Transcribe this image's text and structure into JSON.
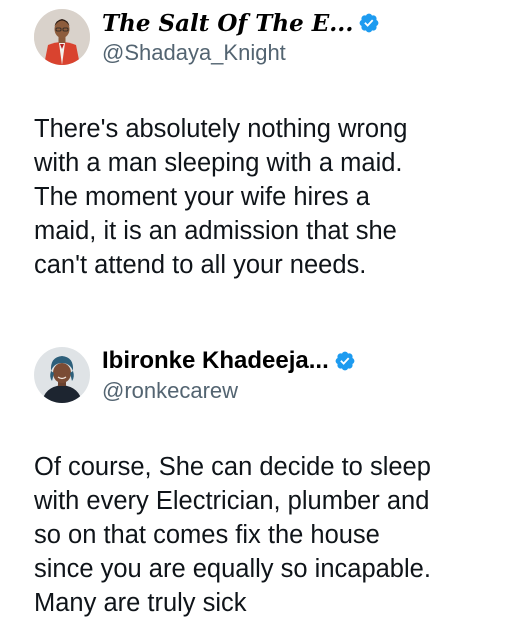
{
  "tweets": [
    {
      "display_name": "The Salt Of The E...",
      "handle": "@Shadaya_Knight",
      "verified": true,
      "avatar_icon": "man-in-red-suit-avatar",
      "text": "There's absolutely nothing wrong\nwith a man sleeping with a maid.\nThe moment your wife hires a\nmaid, it is an admission that she\ncan't attend to all your needs."
    },
    {
      "display_name": "Ibironke Khadeeja...",
      "handle": "@ronkecarew",
      "verified": true,
      "avatar_icon": "woman-in-headwrap-avatar",
      "text": "Of course, She can decide to sleep\nwith every Electrician, plumber and\nso on that comes fix the house\nsince you are equally so incapable.\nMany are truly sick"
    }
  ],
  "colors": {
    "verified_badge": "#1d9bf0",
    "handle": "#536471",
    "text": "#0f1419"
  }
}
